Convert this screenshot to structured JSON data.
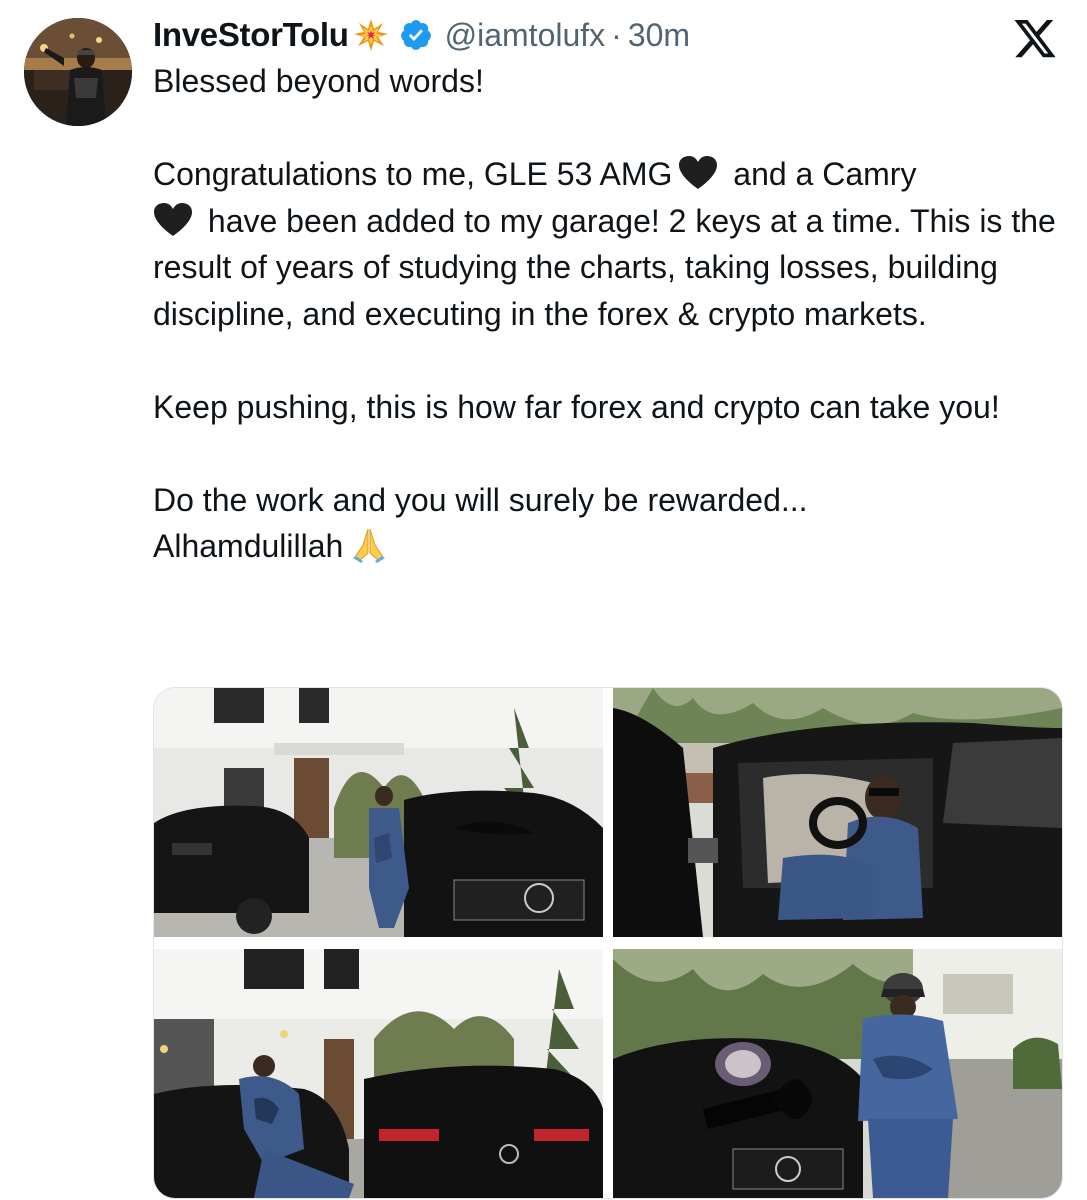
{
  "tweet": {
    "author": {
      "display_name": "InveStorTolu",
      "name_emoji_icon": "collision-spark-icon",
      "verified_icon": "verified-badge-icon",
      "handle": "@iamtolufx",
      "separator": "·",
      "timestamp": "30m"
    },
    "platform_logo": "x-logo-icon",
    "body": {
      "line1": "Blessed beyond words!",
      "para2_part1": "Congratulations to me, GLE 53 AMG",
      "para2_part2": "and a Camry",
      "para2_part3": "have been added to my garage! 2 keys at a time. This is the result of years of studying the charts, taking losses, building discipline, and executing in the forex & crypto markets.",
      "para3": "Keep pushing, this is how far forex and crypto can take you!",
      "para4_line1": "Do the work and you will surely be rewarded...",
      "para4_line2": "Alhamdulillah"
    },
    "emoji_icons": [
      "black-heart-icon",
      "black-heart-icon",
      "folded-hands-icon"
    ],
    "media": [
      {
        "icon": "photo-man-with-cars-at-house"
      },
      {
        "icon": "photo-man-in-car-driver-seat"
      },
      {
        "icon": "photo-man-leaning-on-suv"
      },
      {
        "icon": "photo-man-beside-car-with-bow"
      }
    ]
  },
  "colors": {
    "text": "#0f1419",
    "secondary_text": "#536471",
    "verified_blue": "#1d9bf0",
    "border": "#dfe5ea"
  }
}
